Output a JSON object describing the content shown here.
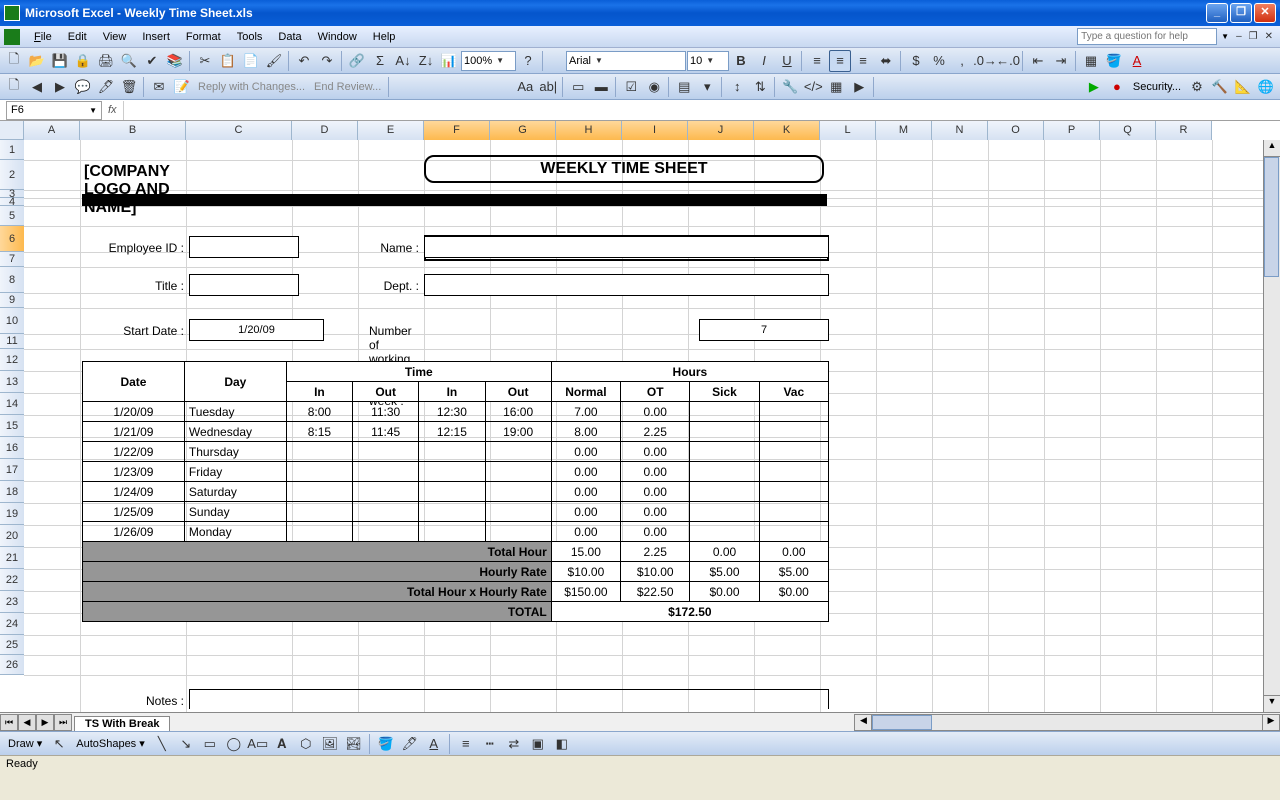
{
  "window": {
    "title": "Microsoft Excel - Weekly Time Sheet.xls"
  },
  "menu": {
    "file": "File",
    "edit": "Edit",
    "view": "View",
    "insert": "Insert",
    "format": "Format",
    "tools": "Tools",
    "data": "Data",
    "window": "Window",
    "help": "Help",
    "helpPlaceholder": "Type a question for help"
  },
  "toolbar": {
    "zoom": "100%",
    "font": "Arial",
    "size": "10",
    "review_reply": "Reply with Changes...",
    "review_end": "End Review...",
    "security": "Security..."
  },
  "namebox": "F6",
  "columns": [
    "A",
    "B",
    "C",
    "D",
    "E",
    "F",
    "G",
    "H",
    "I",
    "J",
    "K",
    "L",
    "M",
    "N",
    "O",
    "P",
    "Q",
    "R"
  ],
  "rows": [
    "1",
    "2",
    "3",
    "4",
    "5",
    "6",
    "7",
    "8",
    "9",
    "10",
    "11",
    "12",
    "13",
    "14",
    "15",
    "16",
    "17",
    "18",
    "19",
    "20",
    "21",
    "22",
    "23",
    "24",
    "25",
    "26"
  ],
  "sheet": {
    "logo": "[COMPANY LOGO AND NAME]",
    "title": "WEEKLY TIME SHEET",
    "labels": {
      "employee_id": "Employee ID :",
      "name": "Name :",
      "title": "Title :",
      "dept": "Dept. :",
      "start_date": "Start Date :",
      "working_days": "Number of working days per week :",
      "notes": "Notes :"
    },
    "values": {
      "start_date": "1/20/09",
      "working_days": "7"
    },
    "table": {
      "headers": {
        "date": "Date",
        "day": "Day",
        "time": "Time",
        "hours": "Hours",
        "in": "In",
        "out": "Out",
        "normal": "Normal",
        "ot": "OT",
        "sick": "Sick",
        "vac": "Vac"
      },
      "rows": [
        {
          "date": "1/20/09",
          "day": "Tuesday",
          "in1": "8:00",
          "out1": "11:30",
          "in2": "12:30",
          "out2": "16:00",
          "normal": "7.00",
          "ot": "0.00",
          "sick": "",
          "vac": ""
        },
        {
          "date": "1/21/09",
          "day": "Wednesday",
          "in1": "8:15",
          "out1": "11:45",
          "in2": "12:15",
          "out2": "19:00",
          "normal": "8.00",
          "ot": "2.25",
          "sick": "",
          "vac": ""
        },
        {
          "date": "1/22/09",
          "day": "Thursday",
          "in1": "",
          "out1": "",
          "in2": "",
          "out2": "",
          "normal": "0.00",
          "ot": "0.00",
          "sick": "",
          "vac": ""
        },
        {
          "date": "1/23/09",
          "day": "Friday",
          "in1": "",
          "out1": "",
          "in2": "",
          "out2": "",
          "normal": "0.00",
          "ot": "0.00",
          "sick": "",
          "vac": ""
        },
        {
          "date": "1/24/09",
          "day": "Saturday",
          "in1": "",
          "out1": "",
          "in2": "",
          "out2": "",
          "normal": "0.00",
          "ot": "0.00",
          "sick": "",
          "vac": ""
        },
        {
          "date": "1/25/09",
          "day": "Sunday",
          "in1": "",
          "out1": "",
          "in2": "",
          "out2": "",
          "normal": "0.00",
          "ot": "0.00",
          "sick": "",
          "vac": ""
        },
        {
          "date": "1/26/09",
          "day": "Monday",
          "in1": "",
          "out1": "",
          "in2": "",
          "out2": "",
          "normal": "0.00",
          "ot": "0.00",
          "sick": "",
          "vac": ""
        }
      ],
      "totals": {
        "total_hour_label": "Total Hour",
        "hourly_rate_label": "Hourly Rate",
        "total_x_rate_label": "Total Hour x Hourly Rate",
        "total_label": "TOTAL",
        "total_hour": {
          "normal": "15.00",
          "ot": "2.25",
          "sick": "0.00",
          "vac": "0.00"
        },
        "hourly_rate": {
          "normal": "$10.00",
          "ot": "$10.00",
          "sick": "$5.00",
          "vac": "$5.00"
        },
        "total_x_rate": {
          "normal": "$150.00",
          "ot": "$22.50",
          "sick": "$0.00",
          "vac": "$0.00"
        },
        "grand_total": "$172.50"
      }
    }
  },
  "tabs": {
    "sheet1": "TS With Break"
  },
  "drawbar": {
    "draw": "Draw",
    "autoshapes": "AutoShapes"
  },
  "status": "Ready"
}
